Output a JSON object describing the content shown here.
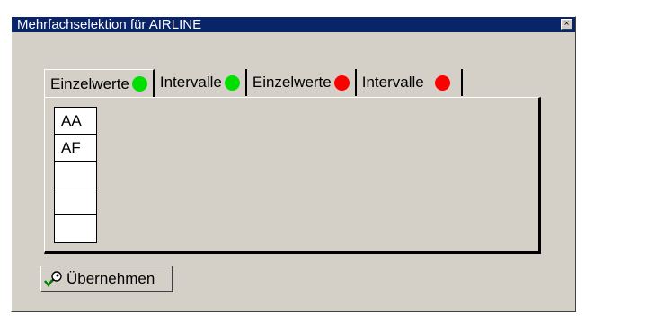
{
  "window": {
    "title": "Mehrfachselektion für AIRLINE",
    "close_glyph": "×"
  },
  "tabs": [
    {
      "label": "Einzelwerte",
      "status_color": "#00e000",
      "active": true
    },
    {
      "label": "Intervalle",
      "status_color": "#00e000",
      "active": false
    },
    {
      "label": "Einzelwerte",
      "status_color": "#ff0000",
      "active": false
    },
    {
      "label": "Intervalle",
      "status_color": "#ff0000",
      "active": false
    }
  ],
  "values": [
    "AA",
    "AF",
    "",
    "",
    ""
  ],
  "apply_button": {
    "label": "Übernehmen",
    "icon": "key-check-icon"
  },
  "colors": {
    "titlebar": "#0a246a",
    "window_bg": "#d4d0c8"
  }
}
